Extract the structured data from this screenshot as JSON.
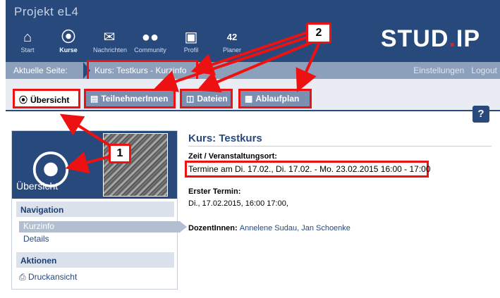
{
  "header": {
    "title": "Projekt eL4",
    "logo_main": "STUD",
    "logo_dot": ".",
    "logo_suffix": "IP",
    "nav": [
      {
        "label": "Start",
        "icon": "home-icon"
      },
      {
        "label": "Kurse",
        "icon": "courses-icon"
      },
      {
        "label": "Nachrichten",
        "icon": "mail-icon"
      },
      {
        "label": "Community",
        "icon": "community-icon"
      },
      {
        "label": "Profil",
        "icon": "profile-icon"
      },
      {
        "label": "Planer",
        "icon": "calendar-icon",
        "badge": "42"
      }
    ]
  },
  "breadcrumb": {
    "label": "Aktuelle Seite:",
    "current": "Kurs: Testkurs - Kurzinfo",
    "settings": "Einstellungen",
    "logout": "Logout"
  },
  "tabs": [
    {
      "label": "Übersicht",
      "icon": "overview-icon"
    },
    {
      "label": "TeilnehmerInnen",
      "icon": "participants-icon"
    },
    {
      "label": "Dateien",
      "icon": "files-icon"
    },
    {
      "label": "Ablaufplan",
      "icon": "schedule-icon"
    }
  ],
  "help": "?",
  "sidebar": {
    "heading": "Übersicht",
    "navigation_title": "Navigation",
    "items": [
      "Kurzinfo",
      "Details"
    ],
    "actions_title": "Aktionen",
    "action_print": "Druckansicht"
  },
  "content": {
    "title": "Kurs: Testkurs",
    "zeit_label": "Zeit / Veranstaltungsort:",
    "zeit_value": "Termine am Di. 17.02., Di. 17.02. - Mo. 23.02.2015 16:00 - 17:00",
    "erster_label": "Erster Termin:",
    "erster_value": "Di., 17.02.2015, 16:00   17:00,",
    "dozent_label": "DozentInnen:",
    "dozent_value": "Annelene Sudau, Jan Schoenke"
  },
  "callouts": {
    "one": "1",
    "two": "2"
  },
  "colors": {
    "brand": "#28497c",
    "annotation": "#e11111",
    "breadcrumb": "#8da0bb"
  }
}
